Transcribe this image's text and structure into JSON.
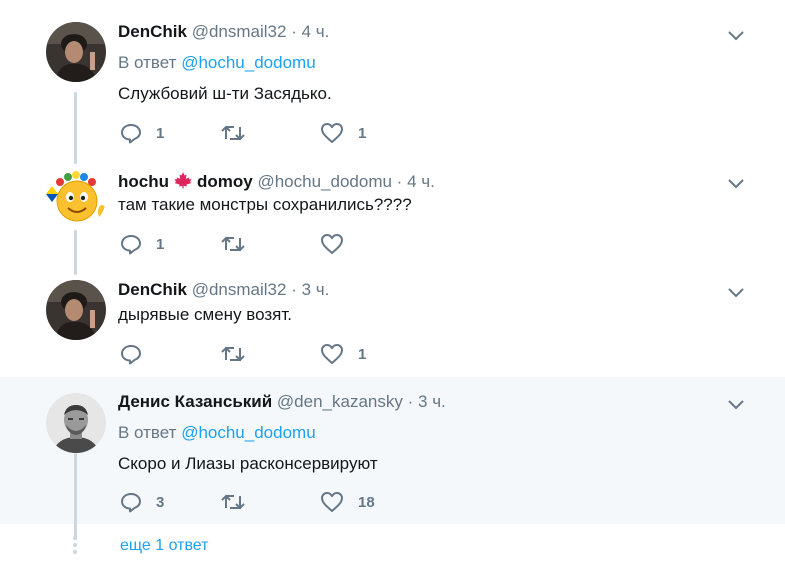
{
  "tweets": [
    {
      "name": "DenChik",
      "handle": "@dnsmail32",
      "time": "4 ч.",
      "reply_prefix": "В ответ",
      "reply_handle": "@hochu_dodomu",
      "text": "Службовий ш-ти Засядько.",
      "reply_count": "1",
      "retweet_count": "",
      "like_count": "1"
    },
    {
      "name_part1": "hochu",
      "name_part2": "domoy",
      "handle": "@hochu_dodomu",
      "time": "4 ч.",
      "text": "там такие монстры сохранились????",
      "reply_count": "1",
      "retweet_count": "",
      "like_count": ""
    },
    {
      "name": "DenChik",
      "handle": "@dnsmail32",
      "time": "3 ч.",
      "text": "дырявые смену возят.",
      "reply_count": "",
      "retweet_count": "",
      "like_count": "1"
    },
    {
      "name": "Денис Казанський",
      "handle": "@den_kazansky",
      "time": "3 ч.",
      "reply_prefix": "В ответ",
      "reply_handle": "@hochu_dodomu",
      "text": "Скоро и Лиазы расконсервируют",
      "reply_count": "3",
      "retweet_count": "",
      "like_count": "18"
    }
  ],
  "separator": "·",
  "more_replies": "еще 1 ответ",
  "colors": {
    "link": "#1da1f2",
    "muted": "#657786",
    "line": "#ccd6dd",
    "highlight_bg": "#f5f8fa",
    "flag_red": "#e0245e"
  }
}
